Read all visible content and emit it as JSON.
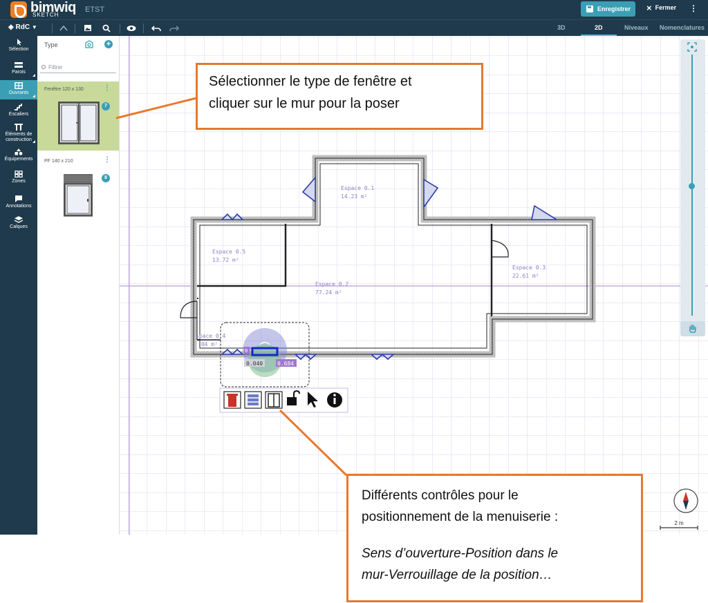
{
  "app": {
    "brand": "bimwiq",
    "brand_sub": "SKETCH",
    "project_name": "ETST",
    "save_label": "Enregistrer",
    "close_label": "Fermer",
    "accent": "#3a9fb5",
    "dark": "#1e3a4c"
  },
  "toolbar": {
    "level_label": "RdC",
    "view_tabs": [
      "3D",
      "2D",
      "Niveaux",
      "Nomenclatures"
    ],
    "active_view": "2D"
  },
  "rail": {
    "items": [
      "Sélection",
      "Parois",
      "Ouvrants",
      "Escaliers",
      "Éléments de construction",
      "Équipements",
      "Zones",
      "Annotations",
      "Calques"
    ],
    "item_lines": {
      "construction_1": "Éléments de",
      "construction_2": "construction"
    },
    "active": "Ouvrants"
  },
  "panel": {
    "title": "Type",
    "filter_placeholder": "Filtrer",
    "cards": [
      {
        "label": "Fenêtre 120 x 130",
        "badge": "7"
      },
      {
        "label": "PF 140 x 210",
        "badge": "8"
      }
    ]
  },
  "plan": {
    "spaces": [
      {
        "name": "Espace 0.1",
        "area": "14.23 m²"
      },
      {
        "name": "Espace 0.5",
        "area": "13.72 m²"
      },
      {
        "name": "Espace 0.2",
        "area": "77.24 m²"
      },
      {
        "name": "Espace 0.3",
        "area": "22.61 m²"
      },
      {
        "name": "Espace 0.4",
        "area": "6.04 m²"
      }
    ],
    "space_visible_labels": {
      "space4_name": "Espace 0.4",
      "space4_area": ".04 m²",
      "space4_prefix": "space 0.4"
    },
    "dim_left": "0.040",
    "dim_right": "0.684",
    "dim_small": "0"
  },
  "context_toolbar": [
    "delete-icon",
    "position-icon",
    "opening-direction-icon",
    "unlock-icon",
    "cursor-icon",
    "info-icon"
  ],
  "scale_label": "2 m",
  "callouts": {
    "c1_line1": "Sélectionner le type de fenêtre et",
    "c1_line2": "cliquer sur le mur pour la poser",
    "c2_line1": "Différents contrôles pour le",
    "c2_line2": "positionnement de la menuiserie :",
    "c2_line3": "Sens d’ouverture-Position dans le",
    "c2_line4": "mur-Verrouillage de la position…"
  }
}
